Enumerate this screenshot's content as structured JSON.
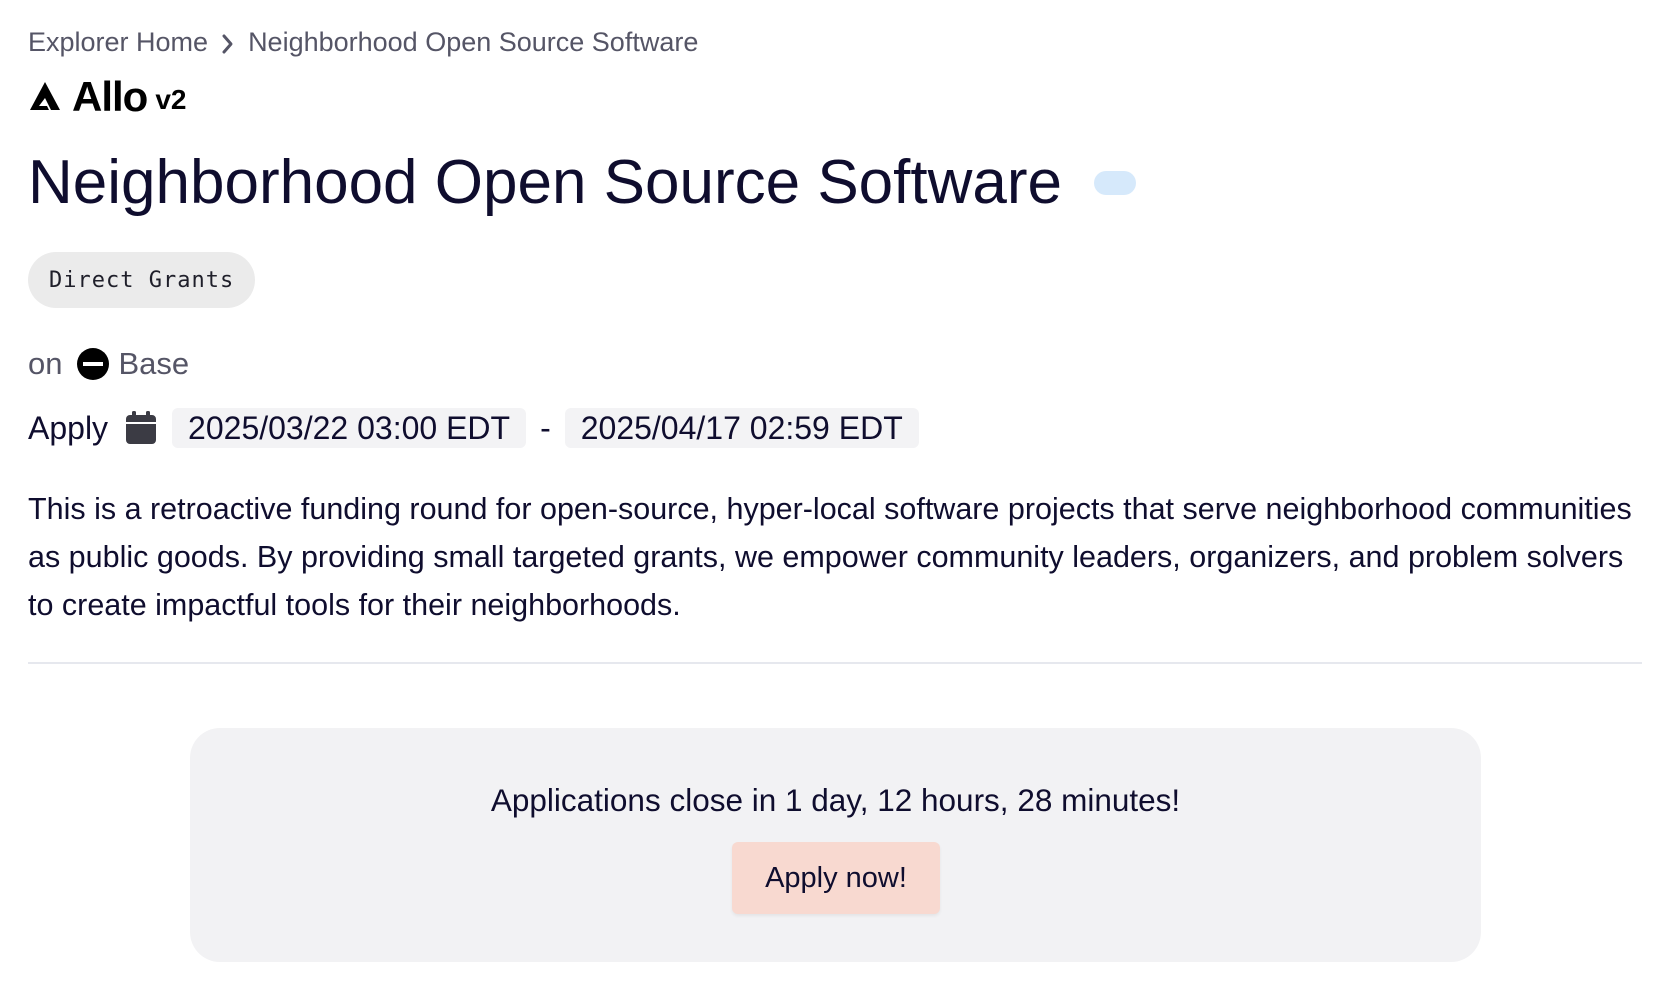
{
  "breadcrumb": {
    "home": "Explorer Home",
    "current": "Neighborhood Open Source Software"
  },
  "logo": {
    "name": "Allo",
    "version": "v2"
  },
  "round": {
    "title": "Neighborhood Open Source Software",
    "tag": "Direct Grants",
    "chain_prefix": "on",
    "chain_name": "Base",
    "apply_label": "Apply",
    "apply_start": "2025/03/22 03:00 EDT",
    "apply_separator": "-",
    "apply_end": "2025/04/17 02:59 EDT",
    "description": "This is a retroactive funding round for open-source, hyper-local software projects that serve neighborhood communities as public goods. By providing small targeted grants, we empower community leaders, organizers, and problem solvers to create impactful tools for their neighborhoods."
  },
  "apply_box": {
    "countdown": "Applications close in 1 day, 12 hours, 28 minutes!",
    "button_label": "Apply now!"
  },
  "colors": {
    "text_primary": "#0f0d2e",
    "text_secondary": "#555566",
    "status_pill": "#d6e9fb",
    "tag_bg": "#ebebeb",
    "box_bg": "#f2f2f4",
    "button_bg": "#f8d9d0"
  },
  "icons": {
    "breadcrumb_separator": "chevron-right-icon",
    "logo": "allo-logo-icon",
    "chain": "base-chain-icon",
    "calendar": "calendar-icon"
  }
}
